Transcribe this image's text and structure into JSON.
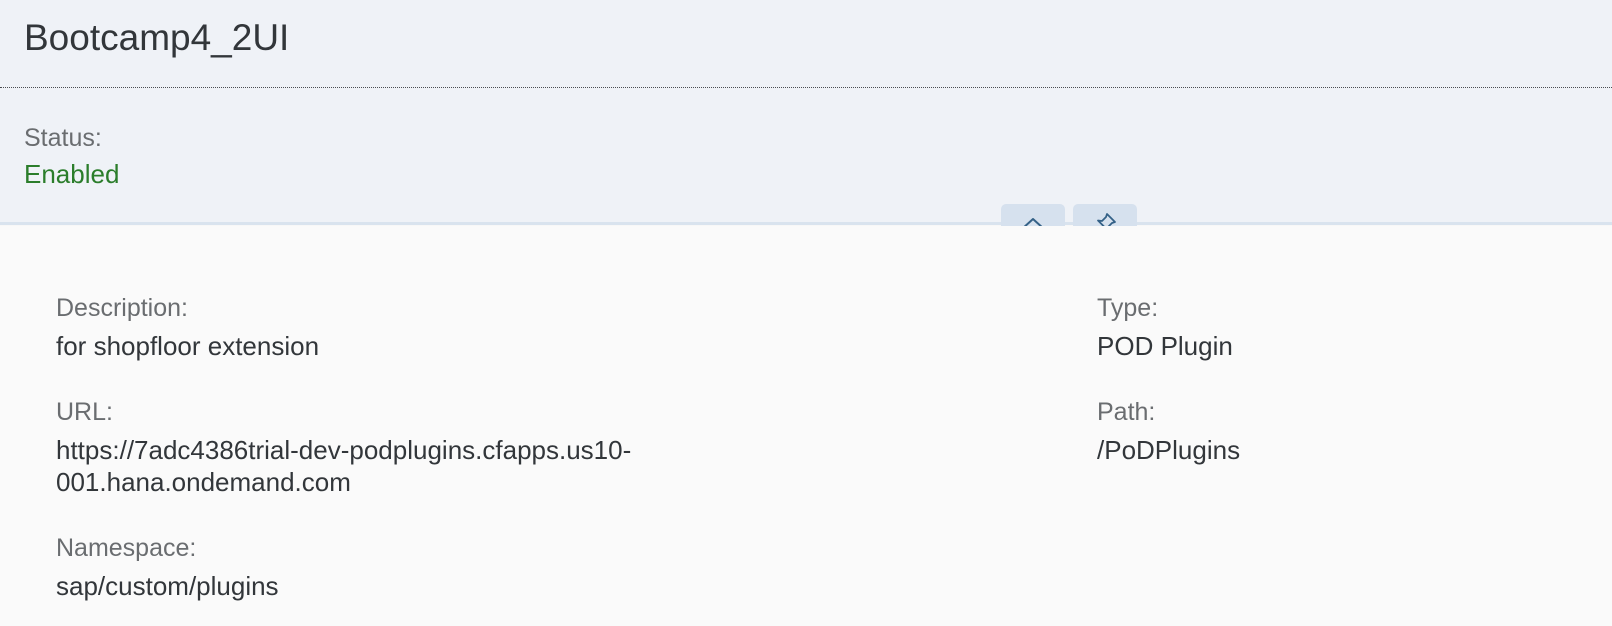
{
  "header": {
    "title": "Bootcamp4_2UI",
    "status_label": "Status:",
    "status_value": "Enabled",
    "status_color": "#2b7d2b",
    "collapse_icon": "chevron-up-icon",
    "pin_icon": "pin-icon"
  },
  "details": {
    "description": {
      "label": "Description:",
      "value": "for shopfloor extension"
    },
    "url": {
      "label": "URL:",
      "value": "https://7adc4386trial-dev-podplugins.cfapps.us10-\n001.hana.ondemand.com"
    },
    "namespace": {
      "label": "Namespace:",
      "value": "sap/custom/plugins"
    },
    "type": {
      "label": "Type:",
      "value": "POD Plugin"
    },
    "path": {
      "label": "Path:",
      "value": "/PoDPlugins"
    }
  },
  "colors": {
    "header_bg": "#eff2f7",
    "content_bg": "#fafafa",
    "button_bg": "#d6e1ee",
    "icon": "#346187"
  }
}
